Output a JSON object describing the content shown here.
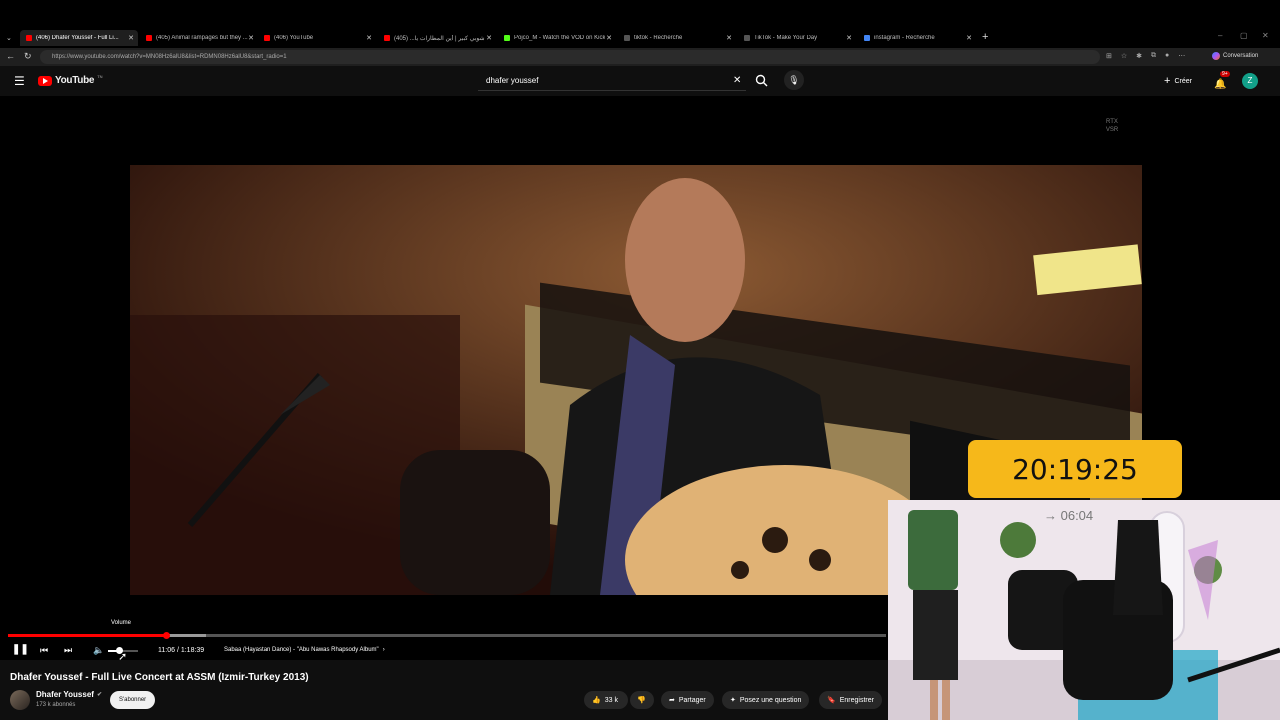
{
  "browser": {
    "tabs": [
      {
        "label": "(406) Dhafer Youssef - Full Li...",
        "active": true,
        "color": "#ff0000"
      },
      {
        "label": "(405) Animal rampages but they ...",
        "active": false,
        "color": "#ff0000"
      },
      {
        "label": "(406) YouTube",
        "active": false,
        "color": "#ff0000"
      },
      {
        "label": "شوبي كبير | أين المطارات يا... (405)",
        "active": false,
        "color": "#ff0000"
      },
      {
        "label": "Pojco_M - Watch the VOD on Kick",
        "active": false,
        "color": "#53fc18"
      },
      {
        "label": "tiktok - Recherche",
        "active": false,
        "color": "#555555"
      },
      {
        "label": "TikTok - Make Your Day",
        "active": false,
        "color": "#555555"
      },
      {
        "label": "instagram - Recherche",
        "active": false,
        "color": "#4285f4"
      }
    ],
    "url": "https://www.youtube.com/watch?v=MN08Hz6alU8&list=RDMN08Hz6alU8&start_radio=1",
    "conversation_label": "Conversation"
  },
  "youtube": {
    "logo_text": "YouTube",
    "logo_country": "TN",
    "search_value": "dhafer youssef",
    "create_label": "Créer",
    "notif_count": "9+",
    "avatar_letter": "Z"
  },
  "player": {
    "rtx_label": "RTX\nVSR",
    "tooltip": "Volume",
    "time": "11:06 / 1:18:39",
    "chapter": "Sabaa (Hayastan Dance) - \"Abu Nawas Rhapsody Album\"",
    "progress_fraction": 0.2
  },
  "overlay": {
    "clock": "20:19:25",
    "countdown": "→ 06:04"
  },
  "video_info": {
    "title": "Dhafer Youssef - Full Live Concert at ASSM (Izmir-Turkey 2013)",
    "channel": "Dhafer Youssef",
    "subscribers": "173 k abonnés",
    "subscribe_label": "S'abonner",
    "likes": "33 k",
    "share_label": "Partager",
    "ask_label": "Posez une question",
    "save_label": "Enregistrer"
  }
}
